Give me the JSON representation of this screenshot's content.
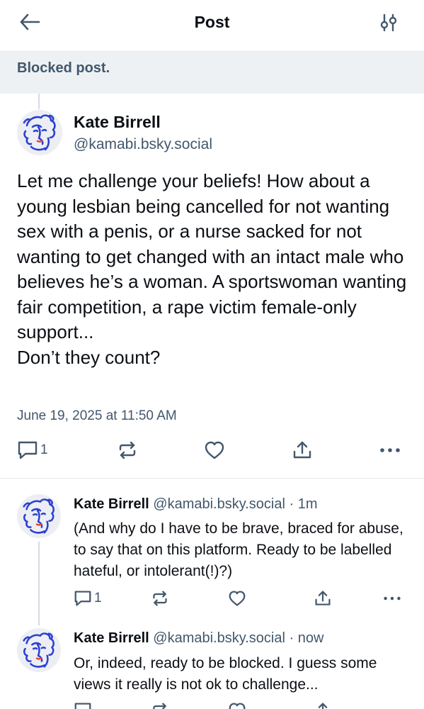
{
  "header": {
    "title": "Post"
  },
  "blocked_notice": "Blocked post.",
  "main_post": {
    "author_name": "Kate Birrell",
    "author_handle": "@kamabi.bsky.social",
    "text": "Let me challenge your beliefs! How about a young lesbian being cancelled for not wanting sex with a penis, or a nurse sacked for not wanting to get changed with an intact male who believes he’s a woman. A sportswoman wanting fair competition, a rape victim female-only support...\nDon’t they count?",
    "timestamp": "June 19, 2025 at 11:50 AM",
    "reply_count": "1"
  },
  "replies": [
    {
      "author_name": "Kate Birrell",
      "author_handle": "@kamabi.bsky.social",
      "separator": " · ",
      "time": "1m",
      "text": "(And why do I have to be brave, braced for abuse, to say that on this platform. Ready to be labelled hateful, or intolerant(!)?)",
      "reply_count": "1"
    },
    {
      "author_name": "Kate Birrell",
      "author_handle": "@kamabi.bsky.social",
      "separator": " · ",
      "time": "now",
      "text": "Or, indeed, ready to be blocked. I guess some views it really is not ok to challenge..."
    }
  ],
  "icons": {
    "back": "arrow-left-icon",
    "filter": "sliders-icon",
    "reply": "speech-bubble-icon",
    "repost": "repost-icon",
    "like": "heart-icon",
    "share": "share-icon",
    "more": "more-horizontal-icon"
  },
  "colors": {
    "text_primary": "#0b0f14",
    "text_secondary": "#42576c",
    "banner_bg": "#eef1f4",
    "thread_line": "#d4dbe2",
    "avatar_ink": "#2b3fd1"
  }
}
